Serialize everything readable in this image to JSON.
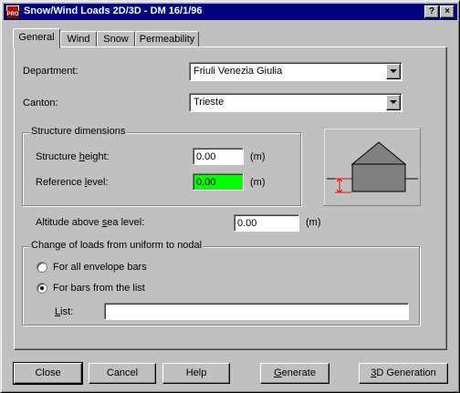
{
  "window": {
    "title": "Snow/Wind Loads 2D/3D - DM 16/1/96",
    "icon_text": "PRO",
    "help_glyph": "?",
    "close_glyph": "×"
  },
  "tabs": [
    {
      "label": "General",
      "active": true
    },
    {
      "label": "Wind",
      "active": false
    },
    {
      "label": "Snow",
      "active": false
    },
    {
      "label": "Permeability",
      "active": false
    }
  ],
  "general": {
    "department_label": "Department:",
    "department_value": "Friuli Venezia Giulia",
    "canton_label": "Canton:",
    "canton_value": "Trieste",
    "structure_group_title": "Structure dimensions",
    "structure_height_label_pre": "Structure ",
    "structure_height_label_ul": "h",
    "structure_height_label_post": "eight:",
    "structure_height_value": "0.00",
    "structure_height_unit": "(m)",
    "reference_level_label_pre": "Reference ",
    "reference_level_label_ul": "l",
    "reference_level_label_post": "evel:",
    "reference_level_value": "0.00",
    "reference_level_unit": "(m)",
    "reference_level_highlight": "#00ff00",
    "altitude_label_pre": "Altitude above ",
    "altitude_label_ul": "s",
    "altitude_label_post": "ea level:",
    "altitude_value": "0.00",
    "altitude_unit": "(m)",
    "loads_group_title": "Change of loads from uniform to nodal",
    "radio_all_label": "For all envelope bars",
    "radio_all_selected": false,
    "radio_list_label": "For bars from the list",
    "radio_list_selected": true,
    "list_label_ul": "L",
    "list_label_post": "ist:",
    "list_value": ""
  },
  "buttons": {
    "close": "Close",
    "cancel": "Cancel",
    "help": "Help",
    "generate_ul": "G",
    "generate_post": "enerate",
    "gen3d_ul": "3",
    "gen3d_post": "D Generation"
  },
  "colors": {
    "titlebar": "#000080",
    "dimension_marker": "#ff0000"
  }
}
